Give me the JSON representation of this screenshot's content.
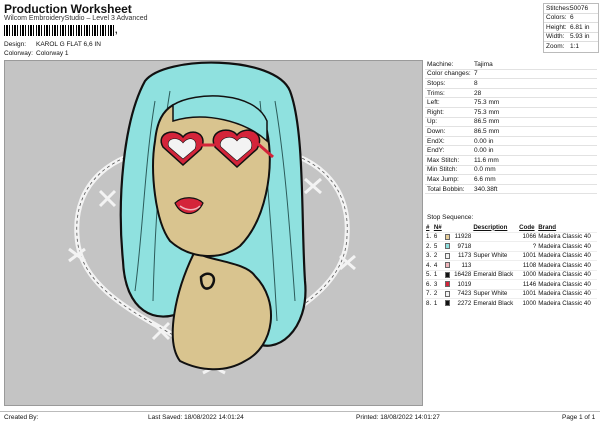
{
  "header": {
    "title": "Production Worksheet",
    "subtitle": "Wilcom EmbroideryStudio – Level 3 Advanced",
    "barcode_mark": ","
  },
  "meta": {
    "design_label": "Design:",
    "design_value": "KAROL G FLAT 6,6 IN",
    "colorway_label": "Colorway:",
    "colorway_value": "Colorway 1"
  },
  "stats": [
    {
      "label": "Stitches:",
      "value": "50076"
    },
    {
      "label": "Colors:",
      "value": "6"
    },
    {
      "label": "Height:",
      "value": "6.81 in"
    },
    {
      "label": "Width:",
      "value": "5.93 in"
    },
    {
      "label": "Zoom:",
      "value": "1:1"
    }
  ],
  "info": [
    {
      "label": "Machine:",
      "value": "Tajima"
    },
    {
      "label": "Color changes:",
      "value": "7"
    },
    {
      "label": "Stops:",
      "value": "8"
    },
    {
      "label": "Trims:",
      "value": "28"
    },
    {
      "label": "Left:",
      "value": "75.3 mm"
    },
    {
      "label": "Right:",
      "value": "75.3 mm"
    },
    {
      "label": "Up:",
      "value": "86.5 mm"
    },
    {
      "label": "Down:",
      "value": "86.5 mm"
    },
    {
      "label": "EndX:",
      "value": "0.00 in"
    },
    {
      "label": "EndY:",
      "value": "0.00 in"
    },
    {
      "label": "Max Stitch:",
      "value": "11.6 mm"
    },
    {
      "label": "Min Stitch:",
      "value": "0.0 mm"
    },
    {
      "label": "Max Jump:",
      "value": "6.6 mm"
    },
    {
      "label": "Total Bobbin:",
      "value": "340.38ft"
    }
  ],
  "sequence": {
    "title": "Stop Sequence:",
    "headers": [
      "#",
      "N#",
      "",
      "Code",
      "Brand"
    ],
    "header_desc": "Description",
    "rows": [
      {
        "stop": "1.",
        "n": "6",
        "color": "#e8cf9a",
        "num": "11928",
        "desc": "",
        "code": "1066",
        "brand": "Madeira Classic 40"
      },
      {
        "stop": "2.",
        "n": "5",
        "color": "#8fe1df",
        "num": "9718",
        "desc": "",
        "code": "?",
        "brand": "Madeira Classic 40"
      },
      {
        "stop": "3.",
        "n": "2",
        "color": "#f3f3f3",
        "num": "1173",
        "desc": "Super White",
        "code": "1001",
        "brand": "Madeira Classic 40"
      },
      {
        "stop": "4.",
        "n": "4",
        "color": "#f0b7bd",
        "num": "113",
        "desc": "",
        "code": "1108",
        "brand": "Madeira Classic 40"
      },
      {
        "stop": "5.",
        "n": "1",
        "color": "#111111",
        "num": "16428",
        "desc": "Emerald Black",
        "code": "1000",
        "brand": "Madeira Classic 40"
      },
      {
        "stop": "6.",
        "n": "3",
        "color": "#d4243a",
        "num": "1019",
        "desc": "",
        "code": "1146",
        "brand": "Madeira Classic 40"
      },
      {
        "stop": "7.",
        "n": "2",
        "color": "#f3f3f3",
        "num": "7423",
        "desc": "Super White",
        "code": "1001",
        "brand": "Madeira Classic 40"
      },
      {
        "stop": "8.",
        "n": "1",
        "color": "#111111",
        "num": "2272",
        "desc": "Emerald Black",
        "code": "1000",
        "brand": "Madeira Classic 40"
      }
    ]
  },
  "footer": {
    "created": "Created By:",
    "saved": "Last Saved: 18/08/2022 14:01:24",
    "printed": "Printed: 18/08/2022 14:01:27",
    "page": "Page 1 of 1"
  },
  "colors": {
    "skin": "#d9c48f",
    "hair": "#8fe1df",
    "glasses": "#d4243a",
    "wire": "#f3f3f3",
    "lips": "#f0b7bd"
  }
}
